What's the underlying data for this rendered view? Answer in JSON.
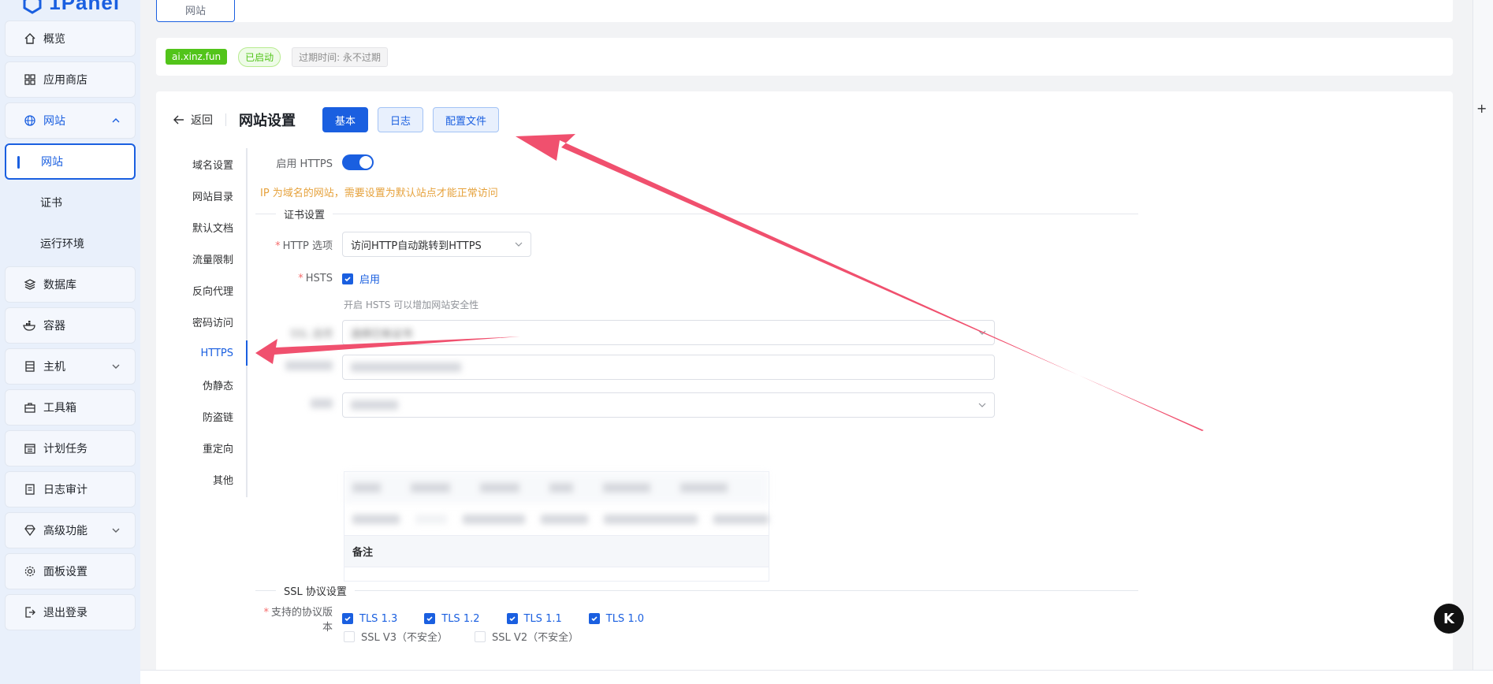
{
  "brand": {
    "name": "1Panel"
  },
  "sidebar": {
    "items": [
      {
        "label": "概览",
        "icon": "home-icon"
      },
      {
        "label": "应用商店",
        "icon": "grid-icon"
      },
      {
        "label": "网站",
        "icon": "globe-icon",
        "expanded": true
      },
      {
        "label": "网站",
        "sub": true,
        "active": true
      },
      {
        "label": "证书",
        "sub": true
      },
      {
        "label": "运行环境",
        "sub": true
      },
      {
        "label": "数据库",
        "icon": "layers-icon"
      },
      {
        "label": "容器",
        "icon": "docker-icon"
      },
      {
        "label": "主机",
        "icon": "server-icon",
        "collapsible": true
      },
      {
        "label": "工具箱",
        "icon": "toolbox-icon"
      },
      {
        "label": "计划任务",
        "icon": "calendar-icon"
      },
      {
        "label": "日志审计",
        "icon": "log-icon"
      },
      {
        "label": "高级功能",
        "icon": "diamond-icon",
        "collapsible": true
      },
      {
        "label": "面板设置",
        "icon": "gear-icon"
      },
      {
        "label": "退出登录",
        "icon": "logout-icon"
      }
    ]
  },
  "top_tab": {
    "label": "网站"
  },
  "info": {
    "domain": "ai.xinz.fun",
    "status": "已启动",
    "expire": "过期时间: 永不过期"
  },
  "header": {
    "back_label": "返回",
    "title": "网站设置",
    "tabs": [
      {
        "label": "基本",
        "active": true
      },
      {
        "label": "日志",
        "active": false
      },
      {
        "label": "配置文件",
        "active": false
      }
    ]
  },
  "subnav": {
    "items": [
      "域名设置",
      "网站目录",
      "默认文档",
      "流量限制",
      "反向代理",
      "密码访问",
      "HTTPS",
      "伪静态",
      "防盗链",
      "重定向",
      "其他"
    ],
    "active": "HTTPS"
  },
  "https_form": {
    "enable_label": "启用 HTTPS",
    "enabled": true,
    "warning": "IP 为域名的网站，需要设置为默认站点才能正常访问",
    "cert_section": "证书设置",
    "http_option_label": "HTTP 选项",
    "http_option_value": "访问HTTP自动跳转到HTTPS",
    "hsts_label": "HSTS",
    "hsts_checkbox": "启用",
    "hsts_checked": true,
    "hsts_hint": "开启 HSTS 可以增加网站安全性",
    "ssl_option_label": "SSL 选项",
    "ssl_option_value": "选择已有证书",
    "cert_table_note_header": "备注",
    "ssl_section": "SSL 协议设置",
    "protocols_label": "支持的协议版本",
    "protocols": [
      {
        "label": "TLS 1.3",
        "checked": true
      },
      {
        "label": "TLS 1.2",
        "checked": true
      },
      {
        "label": "TLS 1.1",
        "checked": true
      },
      {
        "label": "TLS 1.0",
        "checked": true
      }
    ],
    "protocols_unsafe": [
      {
        "label": "SSL V3（不安全）",
        "checked": false
      },
      {
        "label": "SSL V2（不安全）",
        "checked": false
      }
    ]
  },
  "colors": {
    "accent": "#1a5fe0",
    "success": "#52c41a",
    "warning": "#e6a23c",
    "annotation_arrow": "#f0506e"
  },
  "fab": {
    "icon": "k-logo-icon"
  }
}
